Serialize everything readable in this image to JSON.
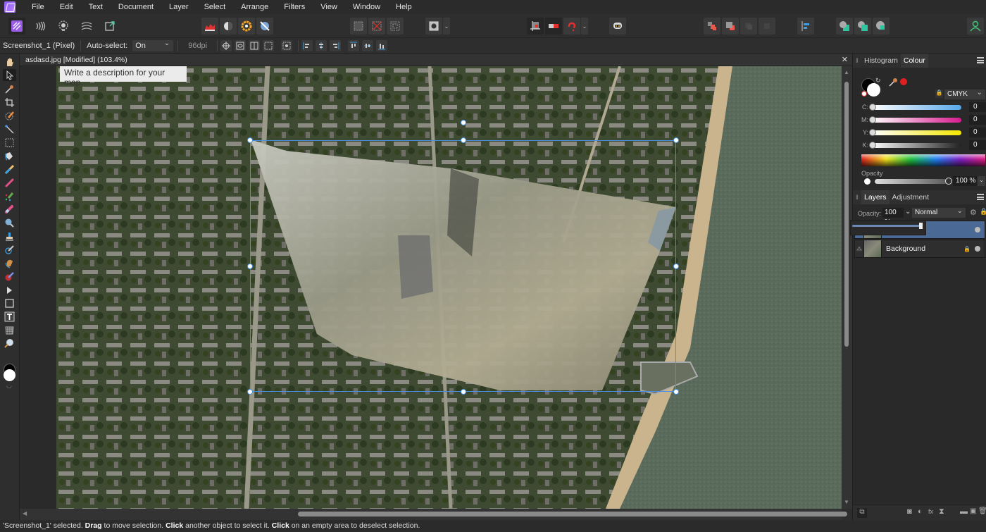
{
  "app": {
    "name": "Affinity Photo",
    "accent": "#4a90e2"
  },
  "menu": [
    "File",
    "Edit",
    "Text",
    "Document",
    "Layer",
    "Select",
    "Arrange",
    "Filters",
    "View",
    "Window",
    "Help"
  ],
  "personas": [
    {
      "name": "photo-persona-icon",
      "active": true
    },
    {
      "name": "liquify-persona-icon",
      "active": false
    },
    {
      "name": "develop-persona-icon",
      "active": false
    },
    {
      "name": "tone-mapping-persona-icon",
      "active": false
    },
    {
      "name": "export-persona-icon",
      "active": false
    }
  ],
  "context": {
    "layer_label": "Screenshot_1 (Pixel)",
    "auto_select_label": "Auto-select:",
    "auto_select_value": "On",
    "dpi": "96dpi"
  },
  "document": {
    "title": "asdasd.jpg [Modified] (103.4%)",
    "map_caption": "Write a description for your map."
  },
  "colour_panel": {
    "tabs": [
      "Histogram",
      "Colour"
    ],
    "active_tab": "Colour",
    "model": "CMYK",
    "channels": [
      {
        "label": "C:",
        "value": "0"
      },
      {
        "label": "M:",
        "value": "0"
      },
      {
        "label": "Y:",
        "value": "0"
      },
      {
        "label": "K:",
        "value": "0"
      }
    ],
    "opacity_label": "Opacity",
    "opacity_value": "100 %",
    "fill_color": "#000000",
    "stroke_color": "#ffffff",
    "picker_color": "#e02020"
  },
  "layers_panel": {
    "tabs": [
      "Layers",
      "Adjustment"
    ],
    "active_tab": "Layers",
    "opacity_label": "Opacity:",
    "opacity_value": "100 %",
    "blend_mode": "Normal",
    "opacity_slider_fraction": 1.0,
    "layers": [
      {
        "name": "",
        "selected": true,
        "locked": false
      },
      {
        "name": "Background",
        "selected": false,
        "locked": true
      }
    ]
  },
  "status": {
    "prefix": "'Screenshot_1' selected. ",
    "b1": "Drag",
    "t1": " to move selection. ",
    "b2": "Click",
    "t2": " another object to select it. ",
    "b3": "Click",
    "t3": " on an empty area to deselect selection."
  }
}
